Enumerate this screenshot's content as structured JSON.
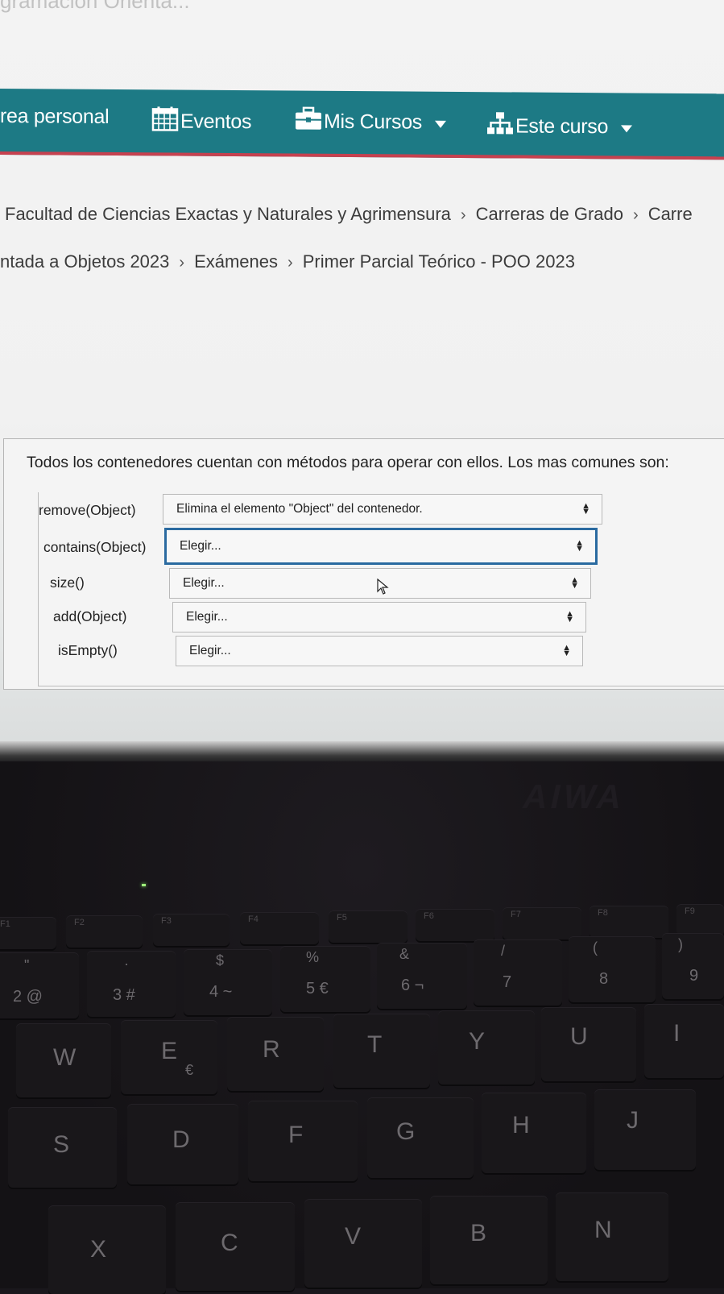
{
  "page": {
    "top_cut_text": "gramación Orienta..."
  },
  "navbar": {
    "items": [
      {
        "label": "rea personal",
        "icon": "none"
      },
      {
        "label": "Eventos",
        "icon": "calendar-icon"
      },
      {
        "label": "Mis Cursos",
        "icon": "briefcase-icon"
      },
      {
        "label": "Este curso",
        "icon": "sitemap-icon"
      }
    ],
    "colors": {
      "background": "#1d7a85",
      "accent": "#c6414f"
    }
  },
  "breadcrumb": {
    "line1": [
      "Facultad de Ciencias Exactas y Naturales y Agrimensura",
      "Carreras de Grado",
      "Carre"
    ],
    "line2": [
      "ntada a Objetos 2023",
      "Exámenes",
      "Primer Parcial Teórico - POO 2023"
    ],
    "separator": "›"
  },
  "question": {
    "prompt": "Todos los contenedores cuentan con métodos para operar con ellos. Los mas comunes son:",
    "rows": [
      {
        "term": "remove(Object)",
        "selected": "Elimina el elemento \"Object\" del contenedor."
      },
      {
        "term": "contains(Object)",
        "selected": "Elegir..."
      },
      {
        "term": "size()",
        "selected": "Elegir..."
      },
      {
        "term": "add(Object)",
        "selected": "Elegir..."
      },
      {
        "term": "isEmpty()",
        "selected": "Elegir..."
      }
    ]
  },
  "keyboard": {
    "brand": "AIWA",
    "fn_keys": [
      "F1",
      "F2",
      "F3",
      "F4",
      "F5",
      "F6",
      "F7",
      "F8",
      "F9"
    ],
    "number_row": [
      {
        "main": "2 @",
        "shift": "\""
      },
      {
        "main": "3 #",
        "shift": "·"
      },
      {
        "main": "4 ~",
        "shift": "$"
      },
      {
        "main": "5 €",
        "shift": "%"
      },
      {
        "main": "6 ¬",
        "shift": "&"
      },
      {
        "main": "7",
        "shift": "/"
      },
      {
        "main": "8",
        "shift": "("
      },
      {
        "main": "9",
        "shift": ")"
      }
    ],
    "qwerty_row": [
      "W",
      "E",
      "R",
      "T",
      "Y",
      "U",
      "I"
    ],
    "qwerty_sub": {
      "E": "€"
    },
    "home_row": [
      "S",
      "D",
      "F",
      "G",
      "H",
      "J"
    ],
    "bottom_row": [
      "X",
      "C",
      "V",
      "B",
      "N"
    ]
  }
}
